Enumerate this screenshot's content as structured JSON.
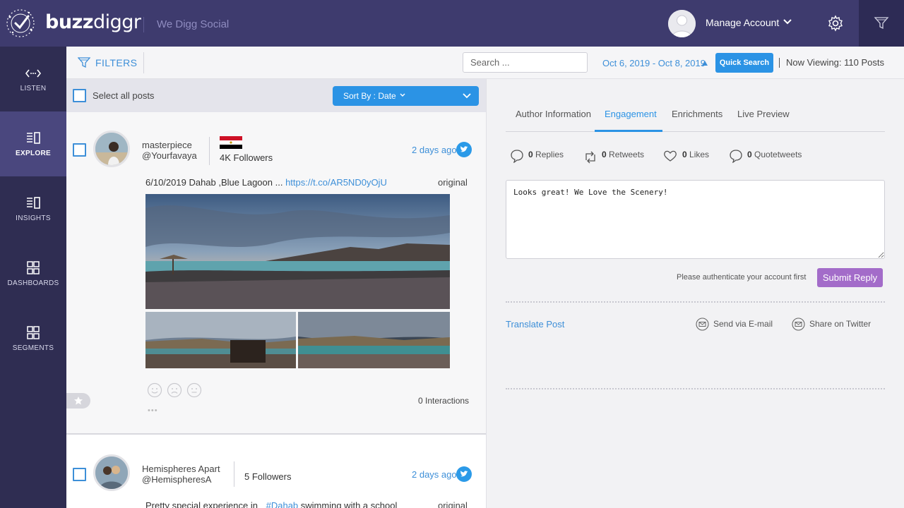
{
  "app": {
    "brand_bold": "buzz",
    "brand_light": "diggr",
    "tagline": "We Digg Social",
    "account_label": "Manage Account"
  },
  "sidebar": {
    "items": [
      {
        "label": "LISTEN",
        "icon": "code-arrows-icon"
      },
      {
        "label": "EXPLORE",
        "icon": "explore-list-icon"
      },
      {
        "label": "INSIGHTS",
        "icon": "insights-list-icon"
      },
      {
        "label": "DASHBOARDS",
        "icon": "grid-icon"
      },
      {
        "label": "SEGMENTS",
        "icon": "grid-icon"
      }
    ],
    "active": "EXPLORE"
  },
  "filterbar": {
    "filters_label": "FILTERS",
    "search_placeholder": "Search ...",
    "date_range": "Oct 6, 2019 - Oct 8, 2019",
    "quick_search": "Quick Search",
    "now_viewing": "Now Viewing: 110 Posts"
  },
  "list": {
    "select_all": "Select all posts",
    "sort_label": "Sort By :  Date"
  },
  "posts": [
    {
      "name": "masterpiece",
      "handle": "@Yourfavaya",
      "followers": "4K Followers",
      "date": "2 days ago",
      "text": "6/10/2019 Dahab ,Blue Lagoon ...",
      "link": "https://t.co/AR5ND0yOjU",
      "type": "original",
      "interactions": "0 Interactions",
      "flag": "egypt-flag-icon"
    },
    {
      "name": "Hemispheres Apart",
      "handle": "@HemispheresA",
      "followers": "5 Followers",
      "date": "2 days ago",
      "text_before": "Pretty special experience in",
      "hashtag": "#Dahab",
      "text_after": "swimming with a school",
      "type": "original"
    }
  ],
  "detail": {
    "tabs": [
      "Author Information",
      "Engagement",
      "Enrichments",
      "Live Preview"
    ],
    "active_tab": "Engagement",
    "metrics": [
      {
        "count": "0",
        "label": "Replies"
      },
      {
        "count": "0",
        "label": "Retweets"
      },
      {
        "count": "0",
        "label": "Likes"
      },
      {
        "count": "0",
        "label": "Quotetweets"
      }
    ],
    "reply_text": "Looks great! We Love the Scenery!",
    "auth_note": "Please authenticate your account first",
    "submit_label": "Submit Reply",
    "translate_label": "Translate Post",
    "send_email": "Send via E-mail",
    "share_twitter": "Share on Twitter"
  },
  "colors": {
    "topbar": "#3e3b6e",
    "sidebar": "#2f2d52",
    "accent": "#2b93e5",
    "submit": "#a36cc9"
  }
}
